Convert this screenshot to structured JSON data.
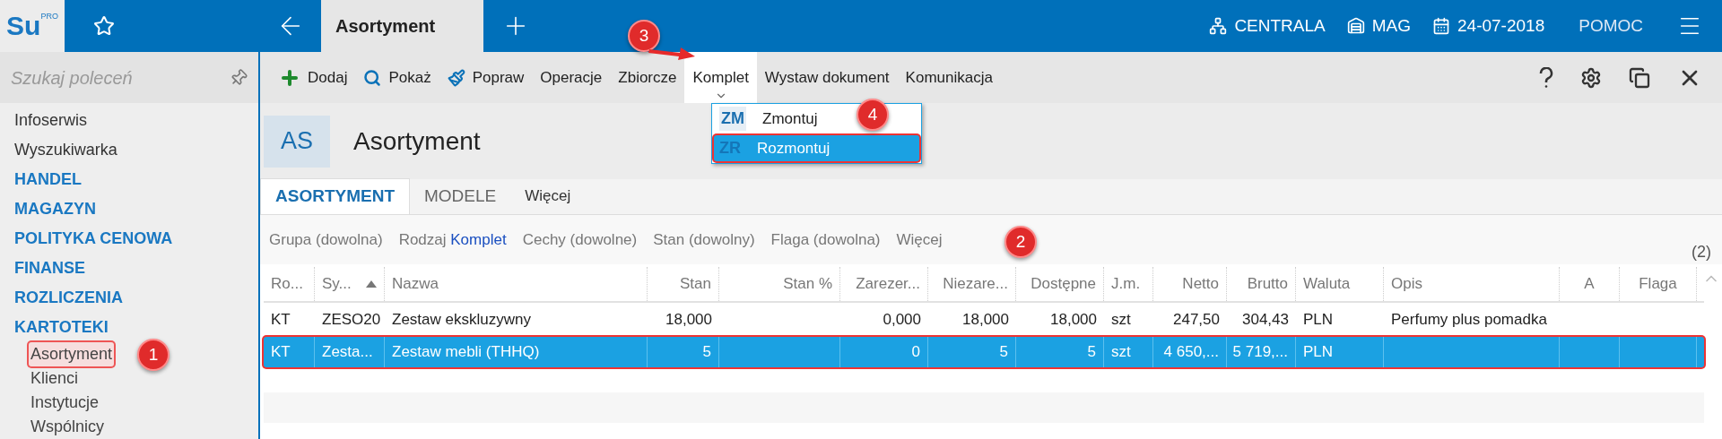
{
  "app": {
    "logo": "Su",
    "logo_sup": "PRO"
  },
  "top_bar": {
    "tab": "Asortyment",
    "items": [
      {
        "kind": "branch",
        "label": "CENTRALA"
      },
      {
        "kind": "warehouse",
        "label": "MAG"
      },
      {
        "kind": "calendar",
        "label": "24-07-2018"
      },
      {
        "kind": "plain",
        "label": "POMOC"
      }
    ]
  },
  "sidebar": {
    "search_placeholder": "Szukaj poleceń",
    "items": [
      {
        "kind": "link",
        "label": "Infoserwis"
      },
      {
        "kind": "link",
        "label": "Wyszukiwarka"
      },
      {
        "kind": "section",
        "label": "HANDEL"
      },
      {
        "kind": "section",
        "label": "MAGAZYN"
      },
      {
        "kind": "section",
        "label": "POLITYKA CENOWA"
      },
      {
        "kind": "section",
        "label": "FINANSE"
      },
      {
        "kind": "section",
        "label": "ROZLICZENIA"
      },
      {
        "kind": "section",
        "label": "KARTOTEKI",
        "children": [
          {
            "label": "Asortyment",
            "selected": true
          },
          {
            "label": "Klienci",
            "selected": false
          },
          {
            "label": "Instytucje",
            "selected": false
          },
          {
            "label": "Wspólnicy",
            "selected": false
          }
        ]
      }
    ]
  },
  "toolbar": [
    {
      "kind": "add",
      "label": "Dodaj",
      "expanded": false
    },
    {
      "kind": "search",
      "label": "Pokaż",
      "expanded": false
    },
    {
      "kind": "brush",
      "label": "Popraw",
      "expanded": false
    },
    {
      "kind": "plain",
      "label": "Operacje",
      "expanded": false
    },
    {
      "kind": "plain",
      "label": "Zbiorcze",
      "expanded": false
    },
    {
      "kind": "plain",
      "label": "Komplet",
      "expanded": true
    },
    {
      "kind": "plain",
      "label": "Wystaw dokument",
      "expanded": false
    },
    {
      "kind": "plain",
      "label": "Komunikacja",
      "expanded": false
    }
  ],
  "dropdown": [
    {
      "code": "ZM",
      "label": "Zmontuj",
      "selected": false
    },
    {
      "code": "ZR",
      "label": "Rozmontuj",
      "selected": true
    }
  ],
  "header": {
    "badge": "AS",
    "title": "Asortyment"
  },
  "tabs": [
    {
      "label": "ASORTYMENT",
      "selected": true
    },
    {
      "label": "MODELE",
      "selected": false
    },
    {
      "label": "Więcej",
      "selected": false
    }
  ],
  "filters": [
    {
      "label": "Grupa (dowolna)"
    },
    {
      "label": "Rodzaj",
      "value": "Komplet"
    },
    {
      "label": "Cechy (dowolne)"
    },
    {
      "label": "Stan (dowolny)"
    },
    {
      "label": "Flaga (dowolna)"
    },
    {
      "label": "Więcej"
    }
  ],
  "count": "(2)",
  "table": {
    "columns": [
      {
        "label": "Ro...",
        "sorted": false
      },
      {
        "label": "Sy...",
        "sorted": true
      },
      {
        "label": "Nazwa",
        "sorted": false
      },
      {
        "label": "Stan",
        "sorted": false
      },
      {
        "label": "Stan %",
        "sorted": false
      },
      {
        "label": "Zarezer...",
        "sorted": false
      },
      {
        "label": "Niezare...",
        "sorted": false
      },
      {
        "label": "Dostępne",
        "sorted": false
      },
      {
        "label": "J.m.",
        "sorted": false
      },
      {
        "label": "Netto",
        "sorted": false
      },
      {
        "label": "Brutto",
        "sorted": false
      },
      {
        "label": "Waluta",
        "sorted": false
      },
      {
        "label": "Opis",
        "sorted": false
      },
      {
        "label": "A",
        "sorted": false
      },
      {
        "label": "Flaga",
        "sorted": false
      }
    ],
    "rows": [
      {
        "selected": false,
        "cells": [
          "KT",
          "ZESO20",
          "Zestaw ekskluzywny",
          "18,000",
          "",
          "0,000",
          "18,000",
          "18,000",
          "szt",
          "247,50",
          "304,43",
          "PLN",
          "Perfumy plus pomadka",
          "",
          ""
        ]
      },
      {
        "selected": true,
        "cells": [
          "KT",
          "Zesta...",
          "Zestaw mebli (THHQ)",
          "5",
          "",
          "0",
          "5",
          "5",
          "szt",
          "4 650,...",
          "5 719,...",
          "PLN",
          "",
          "",
          ""
        ]
      }
    ]
  },
  "callouts": [
    "1",
    "2",
    "3",
    "4"
  ]
}
